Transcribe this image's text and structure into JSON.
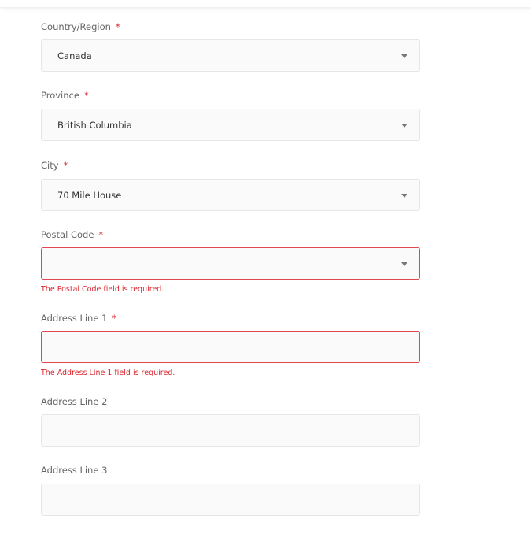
{
  "fields": [
    {
      "label": "Country/Region",
      "required": "*",
      "value": "Canada",
      "type": "select"
    },
    {
      "label": "Province",
      "required": "*",
      "value": "British Columbia",
      "type": "select"
    },
    {
      "label": "City",
      "required": "*",
      "value": "70 Mile House",
      "type": "select"
    },
    {
      "label": "Postal Code",
      "required": "*",
      "value": "",
      "type": "select",
      "error": "The Postal Code field is required."
    },
    {
      "label": "Address Line 1",
      "required": "*",
      "value": "",
      "type": "text",
      "error": "The Address Line 1 field is required."
    },
    {
      "label": "Address Line 2",
      "value": "",
      "type": "text"
    },
    {
      "label": "Address Line 3",
      "value": "",
      "type": "text"
    }
  ],
  "colors": {
    "error": "#d9262e",
    "field_bg": "#fafafa"
  }
}
